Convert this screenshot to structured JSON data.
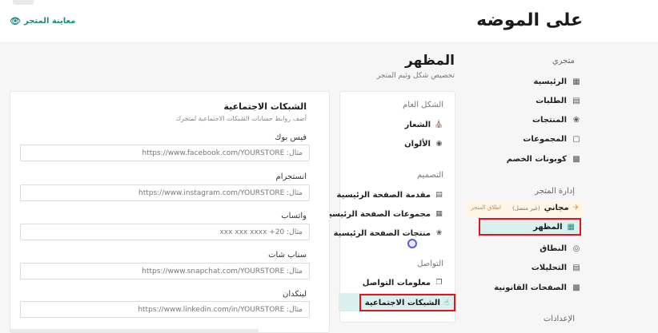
{
  "header": {
    "store_name": "على الموضه",
    "preview_label": "معاينة المتجر",
    "preview_icon": "eye-icon"
  },
  "sidebar": {
    "section_store": "متجري",
    "store_items": [
      {
        "label": "الرئيسية",
        "icon": "home-icon"
      },
      {
        "label": "الطلبات",
        "icon": "orders-icon"
      },
      {
        "label": "المنتجات",
        "icon": "tag-icon"
      },
      {
        "label": "المجموعات",
        "icon": "collection-icon"
      },
      {
        "label": "كوبونات الخصم",
        "icon": "coupon-icon"
      }
    ],
    "section_manage": "إدارة المتجر",
    "plan": {
      "label": "مجاني",
      "status": "(غير متصل)",
      "launch": "اطلاق المتجر",
      "icon": "rocket-icon"
    },
    "active_item": {
      "label": "المظهر",
      "icon": "layout-icon"
    },
    "manage_items": [
      {
        "label": "النطاق",
        "icon": "globe-icon"
      },
      {
        "label": "التحليلات",
        "icon": "chart-icon"
      },
      {
        "label": "الصفحات القانونية",
        "icon": "legal-icon"
      }
    ],
    "section_settings": "الإعدادات"
  },
  "page": {
    "title": "المظهر",
    "subtitle": "تخصيص شكل وثيم المتجر"
  },
  "menu": {
    "group_general": "الشكل العام",
    "general_items": [
      {
        "label": "الشعار",
        "icon": "bank-icon"
      },
      {
        "label": "الألوان",
        "icon": "palette-icon"
      }
    ],
    "group_design": "التصميم",
    "design_items": [
      {
        "label": "مقدمة الصفحة الرئيسية",
        "icon": "page-icon"
      },
      {
        "label": "مجموعات الصفحة الرئيسية",
        "icon": "grid-icon"
      },
      {
        "label": "منتجات الصفحة الرئيسية",
        "icon": "tag-icon"
      }
    ],
    "group_contact": "التواصل",
    "contact_items": [
      {
        "label": "معلومات التواصل",
        "icon": "copy-icon"
      }
    ],
    "active_item": {
      "label": "الشبكات الاجتماعية",
      "icon": "thumbs-up-icon"
    }
  },
  "form": {
    "title": "الشبكات الاجتماعية",
    "subtitle": "أضف روابط حسابات الشبكات الاجتماعية لمتجرك",
    "fields": [
      {
        "label": "فيس بوك",
        "placeholder": "مثال: https://www.facebook.com/YOURSTORE"
      },
      {
        "label": "انستجرام",
        "placeholder": "مثال: https://www.instagram.com/YOURSTORE"
      },
      {
        "label": "واتساب",
        "placeholder": "مثال: 20+ xxx xxx xxxx"
      },
      {
        "label": "سناب شات",
        "placeholder": "مثال: https://www.snapchat.com/YOURSTORE"
      },
      {
        "label": "لينكدان",
        "placeholder": "مثال: https://www.linkedin.com/in/YOURSTORE"
      }
    ]
  },
  "colors": {
    "accent": "#1f8a82",
    "active_bg": "#d9f0ee",
    "highlight_border": "#e0141e",
    "plan_bg": "#fff6e8"
  }
}
